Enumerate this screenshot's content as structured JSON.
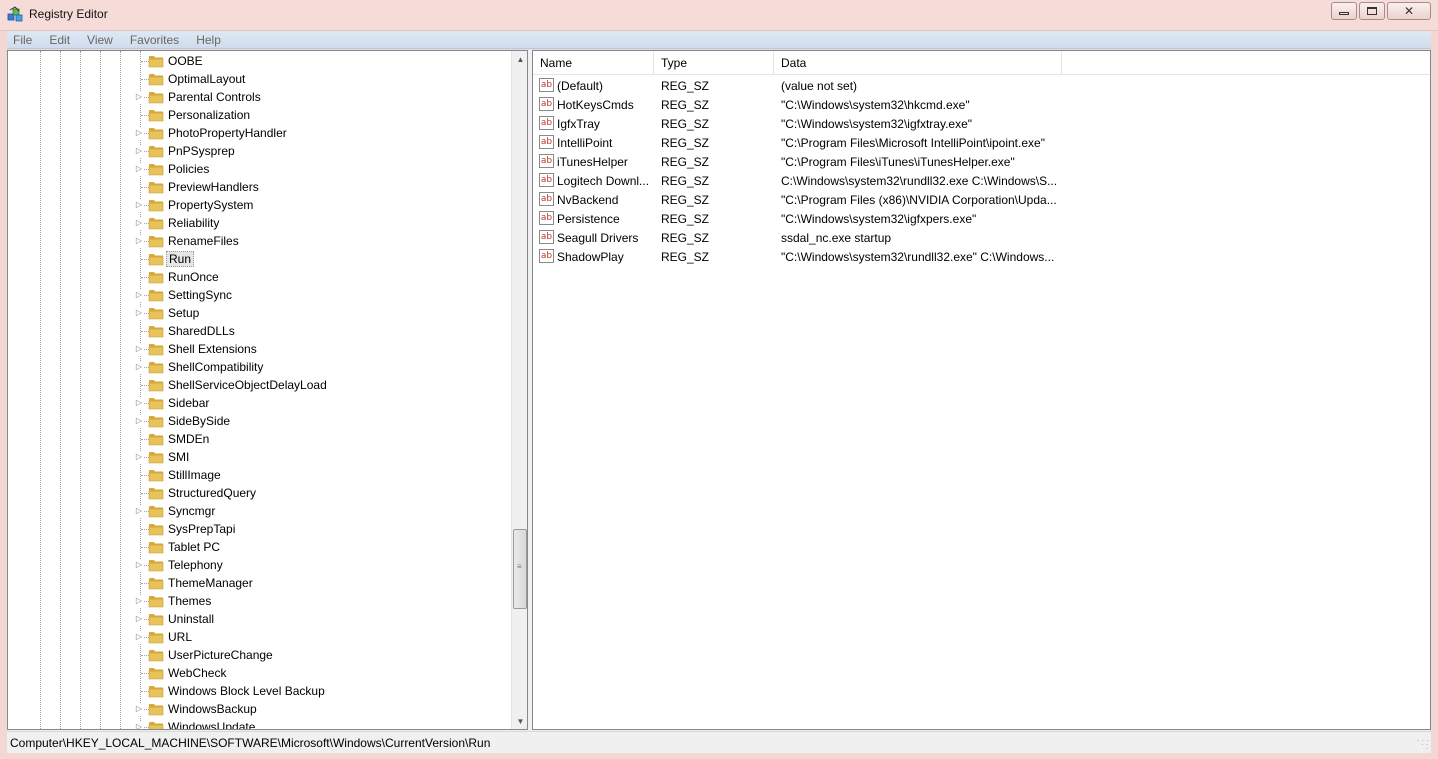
{
  "window": {
    "title": "Registry Editor",
    "controls": {
      "minimize": "▭",
      "maximize": "▢",
      "close": "✕"
    }
  },
  "menu": [
    "File",
    "Edit",
    "View",
    "Favorites",
    "Help"
  ],
  "tree": {
    "selected": "Run",
    "items": [
      {
        "label": "OOBE",
        "expandable": false
      },
      {
        "label": "OptimalLayout",
        "expandable": false
      },
      {
        "label": "Parental Controls",
        "expandable": true
      },
      {
        "label": "Personalization",
        "expandable": false
      },
      {
        "label": "PhotoPropertyHandler",
        "expandable": true
      },
      {
        "label": "PnPSysprep",
        "expandable": true
      },
      {
        "label": "Policies",
        "expandable": true
      },
      {
        "label": "PreviewHandlers",
        "expandable": false
      },
      {
        "label": "PropertySystem",
        "expandable": true
      },
      {
        "label": "Reliability",
        "expandable": true
      },
      {
        "label": "RenameFiles",
        "expandable": true
      },
      {
        "label": "Run",
        "expandable": false
      },
      {
        "label": "RunOnce",
        "expandable": false
      },
      {
        "label": "SettingSync",
        "expandable": true
      },
      {
        "label": "Setup",
        "expandable": true
      },
      {
        "label": "SharedDLLs",
        "expandable": false
      },
      {
        "label": "Shell Extensions",
        "expandable": true
      },
      {
        "label": "ShellCompatibility",
        "expandable": true
      },
      {
        "label": "ShellServiceObjectDelayLoad",
        "expandable": false
      },
      {
        "label": "Sidebar",
        "expandable": true
      },
      {
        "label": "SideBySide",
        "expandable": true
      },
      {
        "label": "SMDEn",
        "expandable": false
      },
      {
        "label": "SMI",
        "expandable": true
      },
      {
        "label": "StillImage",
        "expandable": false
      },
      {
        "label": "StructuredQuery",
        "expandable": false
      },
      {
        "label": "Syncmgr",
        "expandable": true
      },
      {
        "label": "SysPrepTapi",
        "expandable": false
      },
      {
        "label": "Tablet PC",
        "expandable": false
      },
      {
        "label": "Telephony",
        "expandable": true
      },
      {
        "label": "ThemeManager",
        "expandable": false
      },
      {
        "label": "Themes",
        "expandable": true
      },
      {
        "label": "Uninstall",
        "expandable": true
      },
      {
        "label": "URL",
        "expandable": true
      },
      {
        "label": "UserPictureChange",
        "expandable": false
      },
      {
        "label": "WebCheck",
        "expandable": false
      },
      {
        "label": "Windows Block Level Backup",
        "expandable": false
      },
      {
        "label": "WindowsBackup",
        "expandable": true
      },
      {
        "label": "WindowsUpdate",
        "expandable": true
      }
    ]
  },
  "list": {
    "columns": [
      "Name",
      "Type",
      "Data"
    ],
    "rows": [
      {
        "name": "(Default)",
        "type": "REG_SZ",
        "data": "(value not set)"
      },
      {
        "name": "HotKeysCmds",
        "type": "REG_SZ",
        "data": "\"C:\\Windows\\system32\\hkcmd.exe\""
      },
      {
        "name": "IgfxTray",
        "type": "REG_SZ",
        "data": "\"C:\\Windows\\system32\\igfxtray.exe\""
      },
      {
        "name": "IntelliPoint",
        "type": "REG_SZ",
        "data": "\"C:\\Program Files\\Microsoft IntelliPoint\\ipoint.exe\""
      },
      {
        "name": "iTunesHelper",
        "type": "REG_SZ",
        "data": "\"C:\\Program Files\\iTunes\\iTunesHelper.exe\""
      },
      {
        "name": "Logitech Downl...",
        "type": "REG_SZ",
        "data": "C:\\Windows\\system32\\rundll32.exe C:\\Windows\\S..."
      },
      {
        "name": "NvBackend",
        "type": "REG_SZ",
        "data": "\"C:\\Program Files (x86)\\NVIDIA Corporation\\Upda..."
      },
      {
        "name": "Persistence",
        "type": "REG_SZ",
        "data": "\"C:\\Windows\\system32\\igfxpers.exe\""
      },
      {
        "name": "Seagull Drivers",
        "type": "REG_SZ",
        "data": "ssdal_nc.exe startup"
      },
      {
        "name": "ShadowPlay",
        "type": "REG_SZ",
        "data": "\"C:\\Windows\\system32\\rundll32.exe\" C:\\Windows..."
      }
    ]
  },
  "status": {
    "path": "Computer\\HKEY_LOCAL_MACHINE\\SOFTWARE\\Microsoft\\Windows\\CurrentVersion\\Run"
  },
  "icons": {
    "value_icon": "ab",
    "collapsed_arrow": "▷",
    "scroll_up": "▲",
    "scroll_down": "▼",
    "grip": "≡",
    "size_grip": "⋰"
  },
  "colors": {
    "titlebar": "#f6dcd8",
    "menubar": "#d6e2f0",
    "folder": "#e8c35a",
    "selected_item": "#e6e6e6",
    "value_icon_text": "#c0392b"
  }
}
